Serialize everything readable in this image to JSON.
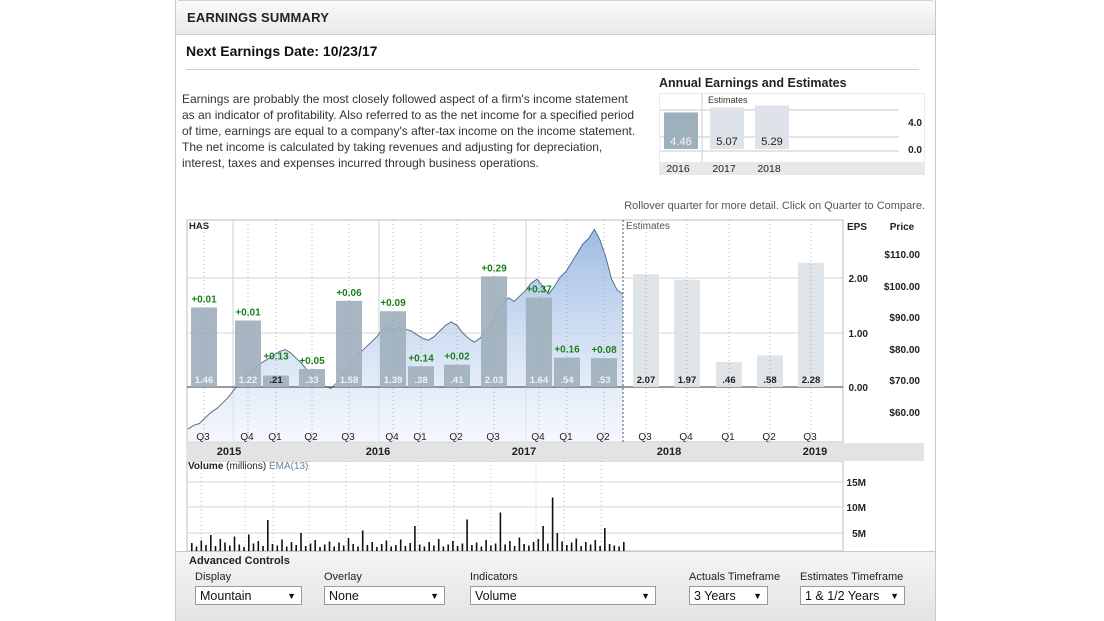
{
  "header": {
    "title": "EARNINGS SUMMARY"
  },
  "next_earnings": "Next Earnings Date: 10/23/17",
  "description": "Earnings are probably the most closely followed aspect of a firm's income statement as an indicator of profitability. Also referred to as the net income for a specified period of time, earnings are equal to a company's after-tax income on the income statement. The net income is calculated by taking revenues and adjusting for depreciation, interest, taxes and expenses incurred through business operations.",
  "rollover_hint": "Rollover quarter for more detail. Click on Quarter to Compare.",
  "colors": {
    "actual_bar": "#9fb0bd",
    "estimate_bar": "#dde3e8",
    "mountain_top": "#98b8e2",
    "surprise": "#1a7f1a"
  },
  "chart_data": [
    {
      "type": "bar",
      "title": "Annual Earnings and Estimates",
      "estimates_label": "Estimates",
      "categories": [
        "2016",
        "2017",
        "2018"
      ],
      "values": [
        4.46,
        5.07,
        5.29
      ],
      "value_labels": [
        "4.46",
        "5.07",
        "5.29"
      ],
      "is_estimate": [
        false,
        true,
        true
      ],
      "ylim": [
        0,
        5
      ],
      "y_ticks": [
        "4.0",
        "0.0"
      ]
    },
    {
      "type": "bar",
      "symbol": "HAS",
      "estimates_label": "Estimates",
      "eps_axis_label": "EPS",
      "price_axis_label": "Price",
      "ylim": [
        0,
        2.5
      ],
      "eps_ticks": [
        "2.00",
        "1.00",
        "0.00"
      ],
      "price_ticks": [
        "$110.00",
        "$100.00",
        "$90.00",
        "$80.00",
        "$70.00",
        "$60.00"
      ],
      "categories": [
        "Q3",
        "Q4",
        "Q1",
        "Q2",
        "Q3",
        "Q4",
        "Q1",
        "Q2",
        "Q3",
        "Q4",
        "Q1",
        "Q2",
        "Q3",
        "Q4",
        "Q1",
        "Q2",
        "Q3"
      ],
      "years": [
        "2015",
        "2016",
        "2017",
        "2018",
        "2019"
      ],
      "values": [
        1.46,
        1.22,
        0.21,
        0.33,
        1.58,
        1.39,
        0.38,
        0.41,
        2.03,
        1.64,
        0.54,
        0.53,
        2.07,
        1.97,
        0.46,
        0.58,
        2.28
      ],
      "value_labels": [
        "1.46",
        "1.22",
        ".21",
        ".33",
        "1.58",
        "1.39",
        ".38",
        ".41",
        "2.03",
        "1.64",
        ".54",
        ".53",
        "2.07",
        "1.97",
        ".46",
        ".58",
        "2.28"
      ],
      "surprises": [
        "+0.01",
        "+0.01",
        "+0.13",
        "+0.05",
        "+0.06",
        "+0.09",
        "+0.14",
        "+0.02",
        "+0.29",
        "+0.37",
        "+0.16",
        "+0.08",
        "",
        "",
        "",
        "",
        ""
      ],
      "is_estimate": [
        false,
        false,
        false,
        false,
        false,
        false,
        false,
        false,
        false,
        false,
        false,
        false,
        true,
        true,
        true,
        true,
        true
      ],
      "price_series": {
        "name": "Price",
        "ylim": [
          55,
          115
        ],
        "values": [
          58.5,
          59.5,
          60,
          61.5,
          63,
          64,
          65.5,
          67,
          69,
          71,
          72.5,
          74,
          75.5,
          76.5,
          77.5,
          78.5,
          79.5,
          80,
          79,
          77.5,
          76,
          74,
          72.5,
          71,
          70,
          69.5,
          71,
          73,
          75.5,
          77.5,
          79,
          80.5,
          82,
          83.5,
          85.5,
          86,
          85.5,
          86,
          85.5,
          85,
          84,
          83,
          82.5,
          83.5,
          85,
          86.5,
          87.5,
          86.5,
          84.5,
          83,
          82,
          83,
          85,
          87,
          90.5,
          92.5,
          94,
          93,
          94.5,
          96,
          98,
          99,
          97,
          95,
          97,
          99.5,
          101,
          103.5,
          106,
          108.5,
          110,
          112.5,
          109.5,
          105,
          99,
          96,
          95
        ]
      }
    },
    {
      "type": "bar",
      "title": "Volume",
      "title_suffix": "(millions)",
      "ema_label": "EMA(13)",
      "ylim": [
        0,
        16
      ],
      "y_ticks": [
        "15M",
        "10M",
        "5M"
      ],
      "values": [
        1.6,
        0.9,
        2.1,
        1.2,
        3.2,
        1.0,
        2.4,
        1.7,
        1.1,
        2.9,
        1.3,
        0.8,
        3.3,
        1.5,
        2.0,
        1.0,
        6.2,
        1.4,
        1.1,
        2.3,
        0.9,
        1.8,
        1.2,
        3.6,
        1.0,
        1.5,
        2.2,
        0.8,
        1.3,
        1.9,
        0.9,
        1.7,
        1.1,
        2.6,
        1.4,
        0.9,
        4.1,
        1.2,
        1.8,
        0.8,
        1.4,
        2.1,
        0.9,
        1.2,
        2.3,
        1.0,
        1.6,
        5.0,
        1.3,
        0.9,
        1.8,
        1.1,
        2.4,
        0.9,
        1.3,
        2.0,
        1.0,
        1.5,
        6.3,
        1.2,
        1.7,
        0.9,
        2.2,
        1.1,
        1.5,
        7.7,
        1.3,
        2.0,
        1.0,
        2.7,
        1.4,
        1.1,
        1.8,
        2.4,
        5.0,
        1.5,
        10.7,
        3.6,
        1.9,
        1.2,
        1.7,
        2.5,
        1.0,
        1.8,
        1.3,
        2.2,
        1.0,
        4.6,
        1.4,
        1.1,
        0.9,
        1.8
      ]
    }
  ],
  "controls": {
    "title": "Advanced Controls",
    "display": {
      "label": "Display",
      "value": "Mountain"
    },
    "overlay": {
      "label": "Overlay",
      "value": "None"
    },
    "indicators": {
      "label": "Indicators",
      "value": "Volume"
    },
    "actuals_timeframe": {
      "label": "Actuals Timeframe",
      "value": "3 Years"
    },
    "estimates_timeframe": {
      "label": "Estimates Timeframe",
      "value": "1 & 1/2 Years"
    }
  }
}
